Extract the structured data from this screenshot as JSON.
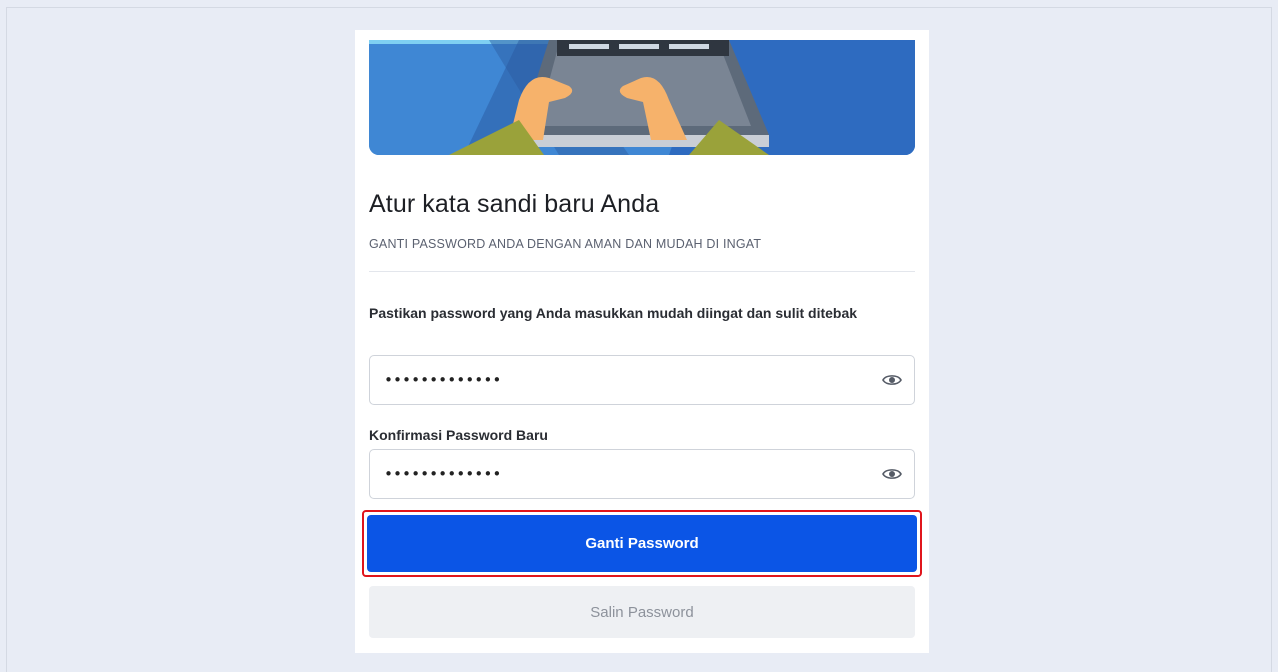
{
  "page": {
    "title": "Atur kata sandi baru Anda",
    "subtitle": "GANTI PASSWORD ANDA DENGAN AMAN DAN MUDAH DI INGAT"
  },
  "form": {
    "new_password": {
      "label": "Pastikan password yang Anda masukkan mudah diingat dan sulit ditebak",
      "value": "•••••••••••••",
      "toggle_icon": "eye-icon"
    },
    "confirm_password": {
      "label": "Konfirmasi Password Baru",
      "value": "•••••••••••••",
      "toggle_icon": "eye-icon"
    },
    "submit_label": "Ganti Password",
    "copy_label": "Salin Password"
  },
  "colors": {
    "primary_button": "#0b55e6",
    "highlight_border": "#e0151c",
    "disabled_button": "#eef0f3",
    "background": "#e8ecf5"
  }
}
